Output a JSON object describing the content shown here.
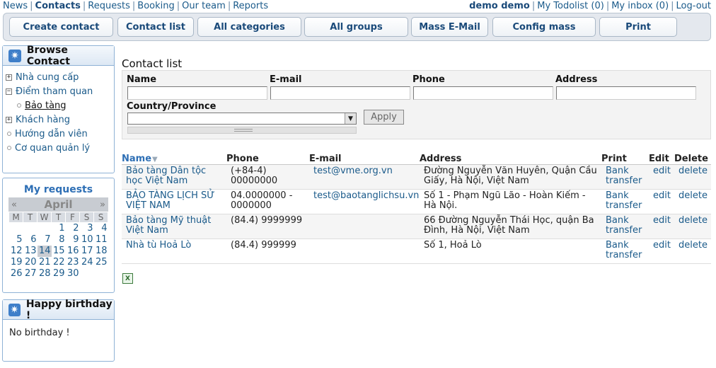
{
  "topnav": {
    "items": [
      "News",
      "Contacts",
      "Requests",
      "Booking",
      "Our team",
      "Reports"
    ],
    "active": "Contacts"
  },
  "usernav": {
    "user": "demo demo",
    "todolist": "My Todolist (0)",
    "inbox": "My inbox (0)",
    "logout": "Log-out"
  },
  "toolbar": {
    "buttons": [
      "Create contact",
      "Contact list",
      "All categories",
      "All groups",
      "Mass E-Mail",
      "Config mass",
      "Print"
    ]
  },
  "browse": {
    "title": "Browse Contact",
    "items": [
      {
        "label": "Nhà cung cấp",
        "marker": "+"
      },
      {
        "label": "Điểm tham quan",
        "marker": "−"
      },
      {
        "label": "Bảo tàng",
        "marker": "dot",
        "sub": true
      },
      {
        "label": "Khách hàng",
        "marker": "+"
      },
      {
        "label": "Hướng dẫn viên",
        "marker": "dot"
      },
      {
        "label": "Cơ quan quản lý",
        "marker": "dot"
      }
    ]
  },
  "requests": {
    "title": "My requests",
    "prev": "«",
    "next": "»",
    "month": "April",
    "weekdays": [
      "M",
      "T",
      "W",
      "T",
      "F",
      "S",
      "S"
    ],
    "weeks": [
      [
        "",
        "",
        "",
        "1",
        "2",
        "3",
        "4"
      ],
      [
        "5",
        "6",
        "7",
        "8",
        "9",
        "10",
        "11"
      ],
      [
        "12",
        "13",
        "14",
        "15",
        "16",
        "17",
        "18"
      ],
      [
        "19",
        "20",
        "21",
        "22",
        "23",
        "24",
        "25"
      ],
      [
        "26",
        "27",
        "28",
        "29",
        "30",
        "",
        ""
      ]
    ],
    "today": "14"
  },
  "birthday": {
    "title": "Happy birthday !",
    "text": "No birthday !"
  },
  "main": {
    "title": "Contact list",
    "filters": {
      "name_label": "Name",
      "email_label": "E-mail",
      "phone_label": "Phone",
      "address_label": "Address",
      "country_label": "Country/Province",
      "apply": "Apply"
    },
    "table": {
      "headers": {
        "name": "Name",
        "phone": "Phone",
        "email": "E-mail",
        "address": "Address",
        "print": "Print",
        "edit": "Edit",
        "delete": "Delete"
      },
      "rows": [
        {
          "name": "Bảo tàng Dân tộc học Việt Nam",
          "phone": "(+84-4) 00000000",
          "email": "test@vme.org.vn",
          "address": "Đường Nguyễn Văn Huyên, Quận Cầu Giấy, Hà Nội, Việt Nam",
          "print": "Bank transfer",
          "edit": "edit",
          "delete": "delete"
        },
        {
          "name": "BẢO TÀNG LỊCH SỬ VIỆT NAM",
          "phone": "04.0000000 - 0000000",
          "email": "test@baotanglichsu.vn",
          "address": "Số 1 - Phạm Ngũ Lão - Hoàn Kiếm - Hà Nội.",
          "print": "Bank transfer",
          "edit": "edit",
          "delete": "delete"
        },
        {
          "name": "Bảo tàng Mỹ thuật Việt Nam",
          "phone": "(84.4) 9999999",
          "email": "",
          "address": "66 Đường Nguyễn Thái Học, quận Ba Đình, Hà Nội, Việt Nam",
          "print": "Bank transfer",
          "edit": "edit",
          "delete": "delete"
        },
        {
          "name": "Nhà tù Hoả Lò",
          "phone": "(84.4) 999999",
          "email": "",
          "address": "Số 1, Hoả Lò",
          "print": "Bank transfer",
          "edit": "edit",
          "delete": "delete"
        }
      ]
    }
  },
  "colors": {
    "link": "#1a5a8a",
    "accent": "#2e6fb5",
    "box_border": "#8fb2d6"
  },
  "icons": {
    "browse": "star-icon",
    "birthday": "star-icon",
    "export": "excel-icon",
    "sort": "sort-down-icon"
  }
}
